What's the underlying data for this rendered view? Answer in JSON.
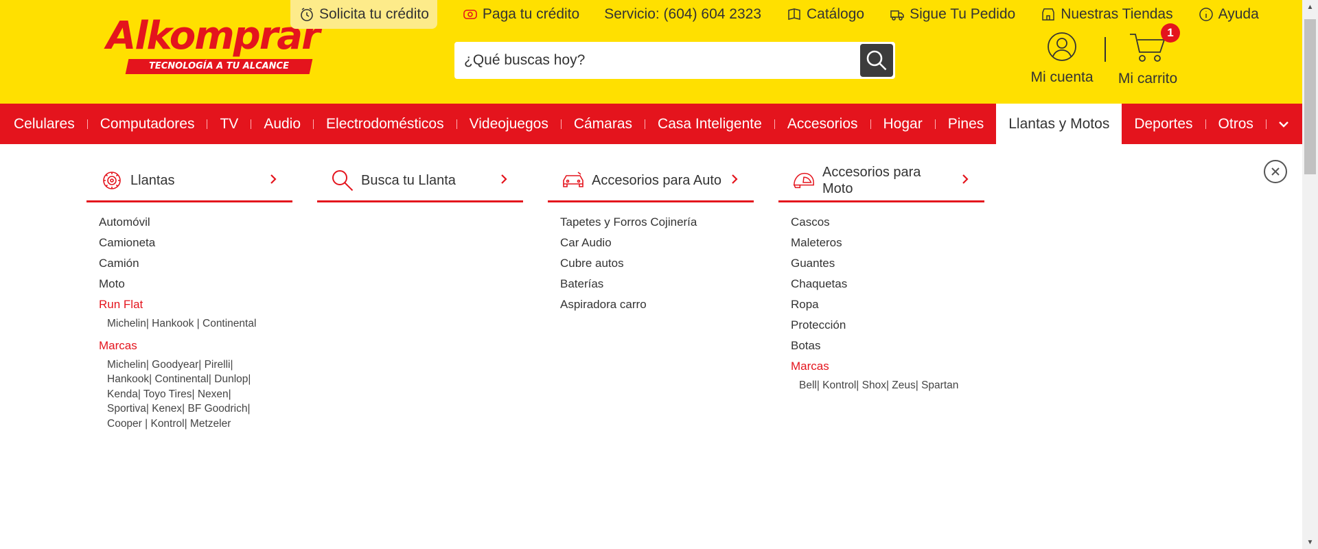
{
  "brand": {
    "name": "Alkomprar",
    "tagline": "TECNOLOGÍA A TU ALCANCE",
    "primary_color": "#e4141d",
    "header_color": "#ffe000"
  },
  "top_links": [
    {
      "label": "Solicita tu crédito",
      "icon": "clock-icon"
    },
    {
      "label": "Paga tu crédito",
      "icon": "money-icon"
    },
    {
      "label": "Servicio: (604) 604 2323",
      "icon": ""
    },
    {
      "label": "Catálogo",
      "icon": "catalog-icon"
    },
    {
      "label": "Sigue Tu Pedido",
      "icon": "truck-icon"
    },
    {
      "label": "Nuestras Tiendas",
      "icon": "store-icon"
    },
    {
      "label": "Ayuda",
      "icon": "info-icon"
    }
  ],
  "search": {
    "placeholder": "¿Qué buscas hoy?",
    "value": ""
  },
  "account": {
    "label": "Mi cuenta"
  },
  "cart": {
    "label": "Mi carrito",
    "count": "1"
  },
  "nav": {
    "items": [
      "Celulares",
      "Computadores",
      "TV",
      "Audio",
      "Electrodomésticos",
      "Videojuegos",
      "Cámaras",
      "Casa Inteligente",
      "Accesorios",
      "Hogar",
      "Pines",
      "Llantas y Motos",
      "Deportes",
      "Otros"
    ],
    "active": "Llantas y Motos"
  },
  "mega_menu": {
    "columns": [
      {
        "title": "Llantas",
        "icon": "tire-icon",
        "items": [
          "Automóvil",
          "Camioneta",
          "Camión",
          "Moto"
        ],
        "section1": {
          "title": "Run Flat",
          "brands": "Michelin| Hankook | Continental"
        },
        "section2": {
          "title": "Marcas",
          "brands": "Michelin| Goodyear| Pirelli| Hankook| Continental| Dunlop| Kenda| Toyo Tires| Nexen| Sportiva| Kenex| BF Goodrich| Cooper | Kontrol| Metzeler"
        }
      },
      {
        "title": "Busca tu Llanta",
        "icon": "search-icon",
        "items": []
      },
      {
        "title": "Accesorios para Auto",
        "icon": "car-icon",
        "items": [
          "Tapetes y Forros Cojinería",
          "Car Audio",
          "Cubre autos",
          "Baterías",
          "Aspiradora carro"
        ]
      },
      {
        "title": "Accesorios para Moto",
        "icon": "helmet-icon",
        "items": [
          "Cascos",
          "Maleteros",
          "Guantes",
          "Chaquetas",
          "Ropa",
          "Protección",
          "Botas"
        ],
        "section1": {
          "title": "Marcas",
          "brands": "Bell| Kontrol| Shox| Zeus| Spartan"
        }
      }
    ]
  }
}
